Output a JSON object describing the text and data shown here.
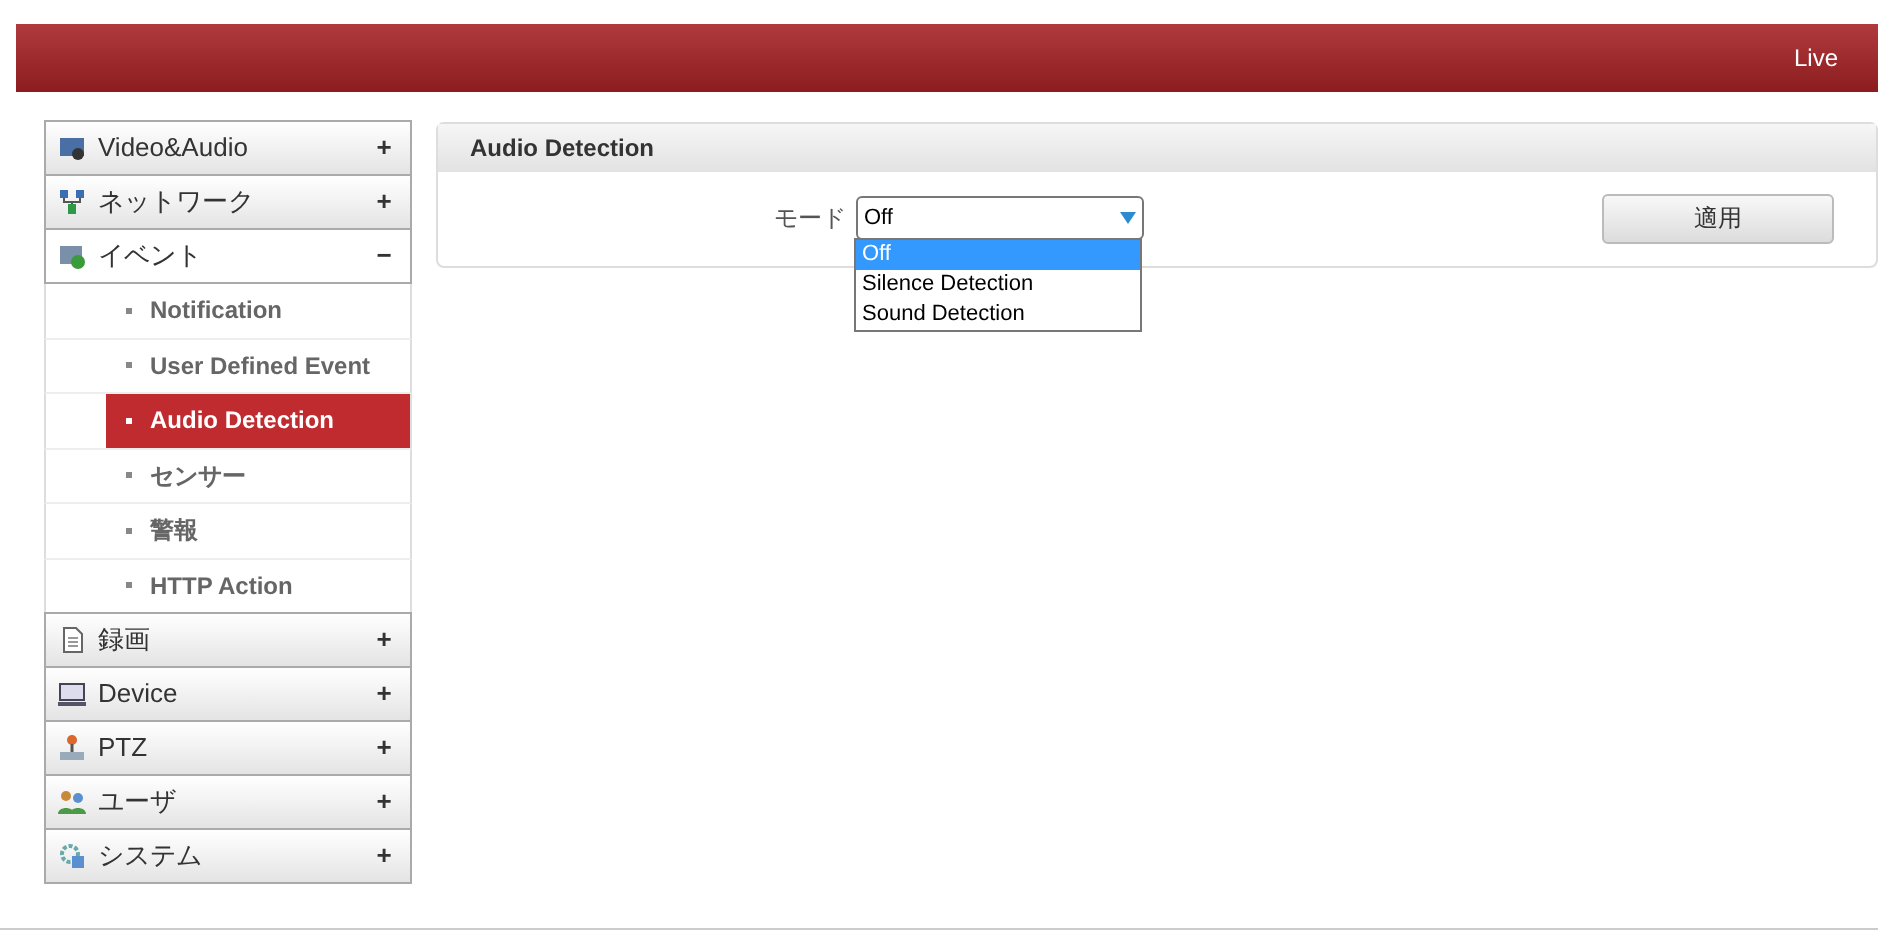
{
  "header": {
    "live_link": "Live"
  },
  "sidebar": {
    "items": [
      {
        "label": "Video&Audio",
        "expanded": false,
        "toggle": "+"
      },
      {
        "label": "ネットワーク",
        "expanded": false,
        "toggle": "+"
      },
      {
        "label": "イベント",
        "expanded": true,
        "toggle": "−",
        "children": [
          {
            "label": "Notification",
            "selected": false
          },
          {
            "label": "User Defined Event",
            "selected": false
          },
          {
            "label": "Audio Detection",
            "selected": true
          },
          {
            "label": "センサー",
            "selected": false
          },
          {
            "label": "警報",
            "selected": false
          },
          {
            "label": "HTTP Action",
            "selected": false
          }
        ]
      },
      {
        "label": "録画",
        "expanded": false,
        "toggle": "+"
      },
      {
        "label": "Device",
        "expanded": false,
        "toggle": "+"
      },
      {
        "label": "PTZ",
        "expanded": false,
        "toggle": "+"
      },
      {
        "label": "ユーザ",
        "expanded": false,
        "toggle": "+"
      },
      {
        "label": "システム",
        "expanded": false,
        "toggle": "+"
      }
    ]
  },
  "panel": {
    "title": "Audio Detection",
    "mode_label": "モード",
    "mode_value": "Off",
    "options": [
      {
        "label": "Off",
        "selected": true
      },
      {
        "label": "Silence Detection",
        "selected": false
      },
      {
        "label": "Sound Detection",
        "selected": false
      }
    ],
    "apply_button": "適用"
  }
}
